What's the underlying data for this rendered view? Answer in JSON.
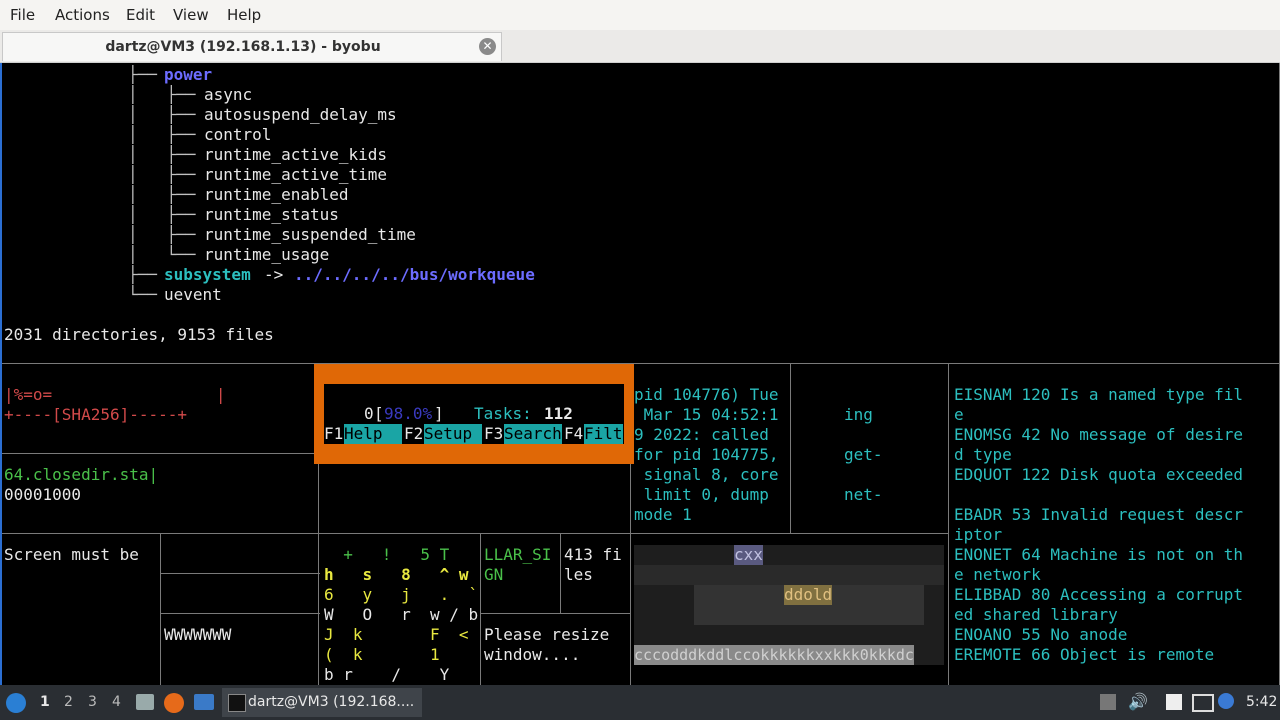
{
  "menu": [
    "File",
    "Actions",
    "Edit",
    "View",
    "Help"
  ],
  "tab": {
    "title": "dartz@VM3 (192.168.1.13) - byobu",
    "close": "✕"
  },
  "tree": {
    "power": "power",
    "items": [
      "async",
      "autosuspend_delay_ms",
      "control",
      "runtime_active_kids",
      "runtime_active_time",
      "runtime_enabled",
      "runtime_status",
      "runtime_suspended_time",
      "runtime_usage"
    ],
    "subsystem": "subsystem",
    "arrow": "->",
    "subsystem_target": "../../../../bus/workqueue",
    "uevent": "uevent",
    "summary": "2031 directories, 9153 files"
  },
  "panes": {
    "sha_top": "|%=o=                 |",
    "sha_bottom": "+----[SHA256]-----+",
    "closedir": "64.closedir.sta|",
    "hex": "00001000",
    "screen_must": "Screen must be",
    "wwww": "WWWWWWW",
    "llar": "LLAR_SI",
    "gn": "GN",
    "files413a": "413 fi",
    "files413b": "les",
    "resize1": "Please resize",
    "resize2": "window....",
    "pid_lines": [
      "pid 104776) Tue",
      " Mar 15 04:52:1",
      "9 2022: called",
      "for pid 104775,",
      " signal 8, core",
      " limit 0, dump",
      "mode 1"
    ],
    "ing": "ing",
    "get": "get-",
    "net": "net-",
    "errno": [
      "EISNAM 120 Is a named type fil",
      "e",
      "ENOMSG 42 No message of desire",
      "d type",
      "EDQUOT 122 Disk quota exceeded",
      "",
      "EBADR 53 Invalid request descr",
      "iptor",
      "ENONET 64 Machine is not on th",
      "e network",
      "ELIBBAD 80 Accessing a corrupt",
      "ed shared library",
      "ENOANO 55 No anode",
      "EREMOTE 66 Object is remote"
    ],
    "rand_rows": [
      "  +   !   5 T",
      "h   s   8   ^ w",
      "6   y   j   .  `",
      "W   O   r  w / b",
      "J  k       F  <",
      "(  k       1  ",
      "b r    /    Y"
    ],
    "ascii_cxx": "cxx",
    "ascii_ddold": "ddold",
    "ascii_bottom": "cccodddkddlccokkkkkkxxkkk0kkkdc"
  },
  "htop": {
    "cpu_label": "0",
    "cpu_val": "98.0%",
    "tasks_label": "Tasks:",
    "tasks_val": "112",
    "keys": [
      {
        "k": "F1",
        "v": "Help  "
      },
      {
        "k": "F2",
        "v": "Setup "
      },
      {
        "k": "F3",
        "v": "Search"
      },
      {
        "k": "F4",
        "v": "Filt"
      }
    ]
  },
  "taskbar": {
    "workspaces": [
      "1",
      "2",
      "3",
      "4"
    ],
    "window": "dartz@VM3 (192.168....",
    "clock": "5:42"
  }
}
